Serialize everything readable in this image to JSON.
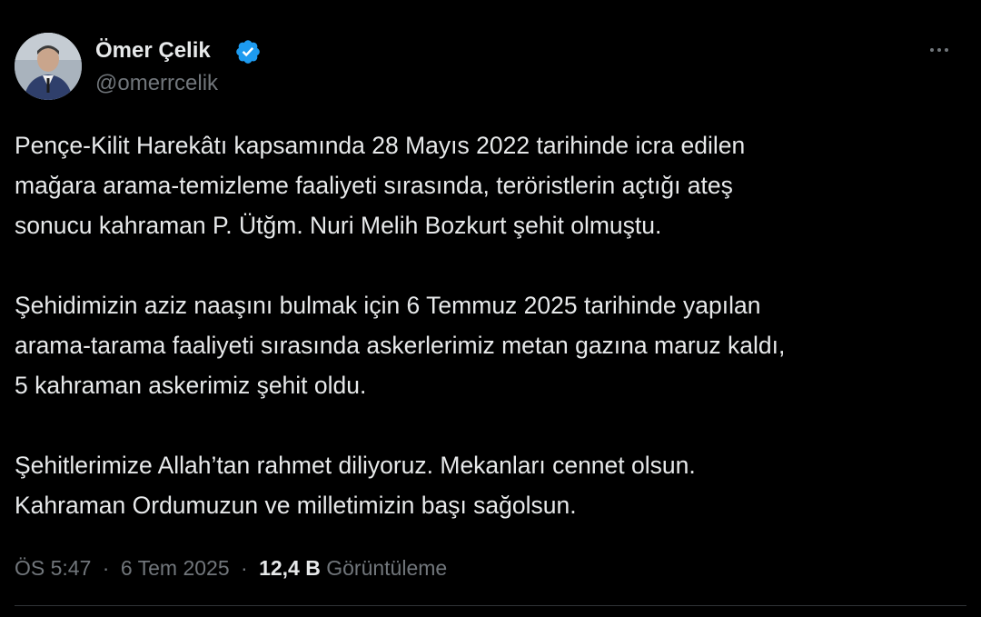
{
  "author": {
    "display_name": "Ömer Çelik",
    "handle": "@omerrcelik",
    "verified_color": "#1d9bf0",
    "avatar_icon": "person-avatar"
  },
  "tweet": {
    "paragraphs": [
      [
        "Pençe-Kilit Harekâtı kapsamında 28 Mayıs 2022 tarihinde icra edilen",
        "mağara arama-temizleme faaliyeti sırasında, teröristlerin açtığı ateş",
        "sonucu kahraman P. Ütğm. Nuri Melih Bozkurt şehit olmuştu."
      ],
      [
        "Şehidimizin aziz naaşını bulmak için 6 Temmuz 2025 tarihinde yapılan",
        "arama-tarama faaliyeti sırasında askerlerimiz metan gazına maruz kaldı,",
        "5 kahraman askerimiz şehit oldu."
      ],
      [
        "Şehitlerimize Allah’tan rahmet diliyoruz. Mekanları cennet olsun.",
        "Kahraman Ordumuzun ve milletimizin başı sağolsun."
      ]
    ]
  },
  "meta": {
    "time": "ÖS 5:47",
    "separator": "·",
    "date": "6 Tem 2025",
    "views_count": "12,4 B",
    "views_label": "Görüntüleme"
  },
  "colors": {
    "background": "#000000",
    "text_primary": "#e7e9ea",
    "text_secondary": "#71767b",
    "divider": "#2f3336"
  }
}
